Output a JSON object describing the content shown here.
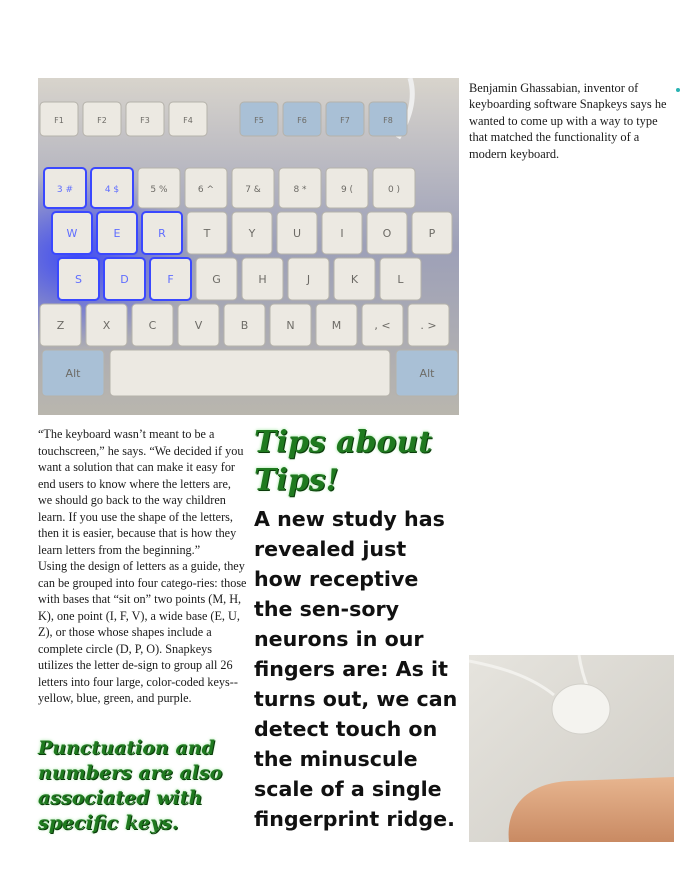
{
  "photos": {
    "keyboard_photo": {
      "function_keys": [
        "F1",
        "F2",
        "F3",
        "F4",
        "F5",
        "F6",
        "F7",
        "F8"
      ],
      "number_row": [
        "3 #",
        "4 $",
        "5 %",
        "6 ^",
        "7 &",
        "8 *",
        "9 (",
        "0 )"
      ],
      "row_q": [
        "W",
        "E",
        "R",
        "T",
        "Y",
        "U",
        "I",
        "O",
        "P"
      ],
      "row_a": [
        "S",
        "D",
        "F",
        "G",
        "H",
        "J",
        "K",
        "L"
      ],
      "row_z": [
        "Z",
        "X",
        "C",
        "V",
        "B",
        "N",
        "M",
        ", <",
        ". >"
      ],
      "alt_left": "Alt",
      "alt_right": "Alt"
    },
    "finger_photo": {}
  },
  "article": {
    "caption": "Benjamin Ghassabian, inventor of keyboarding software Snapkeys says he wanted to come up with a way to type that matched the functionality of a modern keyboard.",
    "quote_paragraph": "“The keyboard wasn’t meant to be a touchscreen,” he says. “We decided if you want a solution that can make it easy for end users to know where the letters are, we should go back to the way children learn. If you use the shape of the letters, then it is easier, because that is how they learn letters from the beginning.”",
    "design_paragraph": "Using the design of letters as a guide, they can be grouped into four catego-ries: those with bases that “sit on” two points (M, H, K), one point (I, F, V), a wide base (E, U, Z), or those whose shapes include a complete circle (D, P, O). Snapkeys utilizes the letter de-sign to group all 26 letters into four large, color-coded keys--yellow, blue, green, and purple.",
    "punctuation_heading": "Punctuation and numbers are also associated with specific keys.",
    "tips_heading": "Tips about Tips!",
    "study_text": "A new study has revealed just how receptive the sen-sory neurons in our fingers are: As it turns out, we can detect touch on the minuscule scale of a single fingerprint ridge."
  },
  "colors": {
    "heading_green": "#1f7a1f",
    "accent_dot": "#2ab3b3",
    "key_backlight_blue": "#2f3cff"
  }
}
